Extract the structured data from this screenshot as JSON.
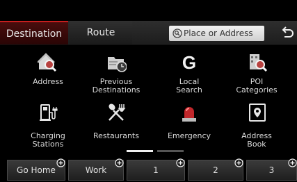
{
  "tabs": {
    "destination": "Destination",
    "route": "Route"
  },
  "search": {
    "placeholder": "Place or Address"
  },
  "grid": [
    {
      "label": "Address",
      "icon": "house-search-icon"
    },
    {
      "label": "Previous\nDestinations",
      "icon": "folder-clock-icon"
    },
    {
      "label": "Local\nSearch",
      "icon": "google-g-icon"
    },
    {
      "label": "POI\nCategories",
      "icon": "building-search-icon"
    },
    {
      "label": "Charging\nStations",
      "icon": "ev-charger-icon"
    },
    {
      "label": "Restaurants",
      "icon": "fork-spoon-icon"
    },
    {
      "label": "Emergency",
      "icon": "siren-icon"
    },
    {
      "label": "Address\nBook",
      "icon": "address-book-icon"
    }
  ],
  "pager": {
    "page": 1,
    "pages": 2
  },
  "favorites": [
    {
      "label": "Go Home"
    },
    {
      "label": "Work"
    },
    {
      "label": "1"
    },
    {
      "label": "2"
    },
    {
      "label": "3"
    }
  ],
  "colors": {
    "accent": "#c81e1e",
    "background": "#000000"
  }
}
